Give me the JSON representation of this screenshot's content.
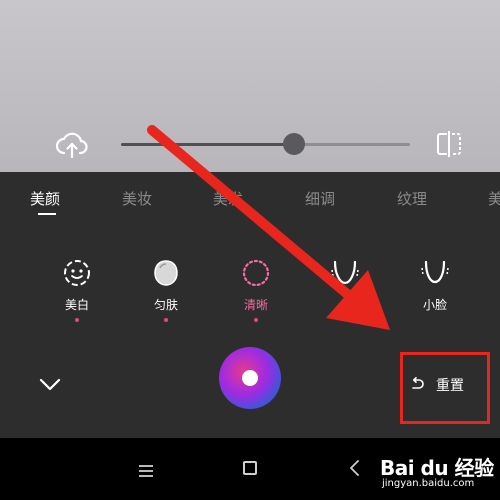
{
  "slider": {
    "value": 0.6
  },
  "tabs": [
    {
      "label": "美颜",
      "active": true
    },
    {
      "label": "美妆",
      "active": false
    },
    {
      "label": "美发",
      "active": false
    },
    {
      "label": "细调",
      "active": false
    },
    {
      "label": "纹理",
      "active": false
    },
    {
      "label": "美",
      "active": false
    }
  ],
  "features": [
    {
      "label": "美白",
      "icon": "face-smile-icon",
      "active": false
    },
    {
      "label": "匀肤",
      "icon": "egg-shield-icon",
      "active": false
    },
    {
      "label": "清晰",
      "icon": "dotted-circle-icon",
      "active": true
    },
    {
      "label": "",
      "icon": "chin-v-icon",
      "active": false
    },
    {
      "label": "小脸",
      "icon": "face-slim-icon",
      "active": false
    }
  ],
  "reset": {
    "label": "重置"
  },
  "watermark": {
    "logo": "Bai du 经验",
    "url": "jingyan.baidu.com"
  },
  "colors": {
    "accent_pink": "#f36ba4",
    "annotation_red": "#e8261e",
    "panel_bg": "#2d2d2d"
  }
}
